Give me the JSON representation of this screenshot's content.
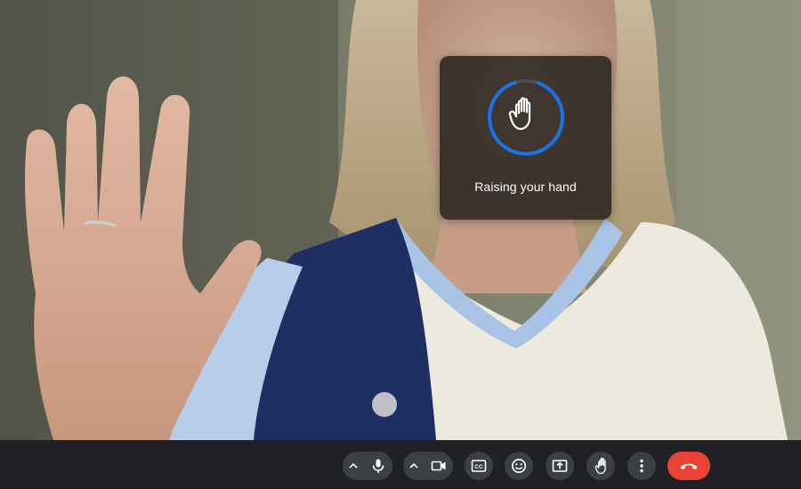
{
  "toast": {
    "label": "Raising your hand",
    "ring_color": "#1a73e8",
    "icon": "hand-raise-icon"
  },
  "controls": {
    "mic": {
      "icon": "microphone-icon",
      "options_icon": "chevron-up-icon"
    },
    "camera": {
      "icon": "video-camera-icon",
      "options_icon": "chevron-up-icon"
    },
    "captions": {
      "icon": "closed-captions-icon",
      "label": "CC"
    },
    "reactions": {
      "icon": "emoji-icon"
    },
    "present": {
      "icon": "present-screen-icon"
    },
    "raise_hand": {
      "icon": "hand-raise-icon"
    },
    "more": {
      "icon": "more-vert-icon"
    },
    "leave": {
      "icon": "phone-hangup-icon",
      "color": "#ea4335"
    }
  },
  "colors": {
    "bar_background": "#202124",
    "button_background": "#3c4043",
    "icon_color": "#ffffff"
  }
}
